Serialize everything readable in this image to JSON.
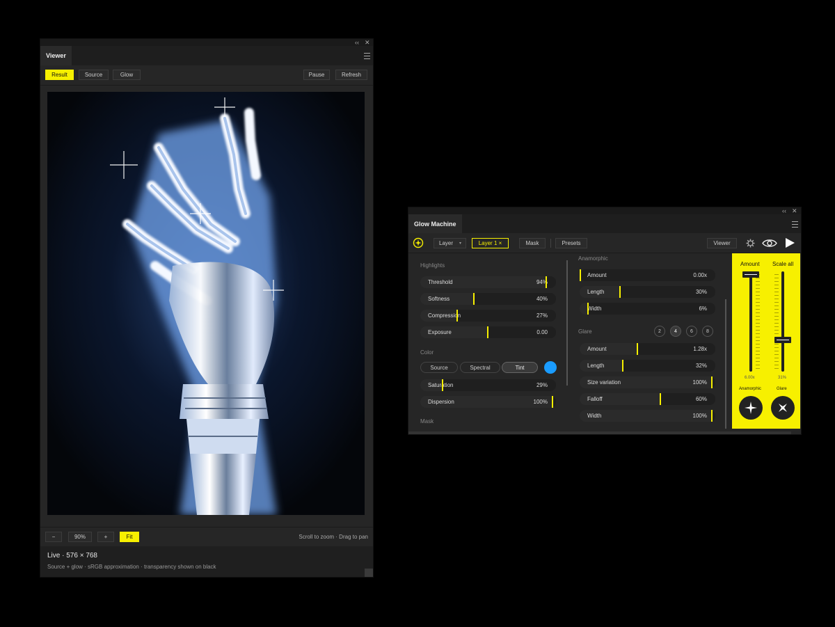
{
  "viewer": {
    "tab": "Viewer",
    "toolbar": {
      "result": "Result",
      "source": "Source",
      "glow": "Glow",
      "pause": "Pause",
      "refresh": "Refresh"
    },
    "zoom": {
      "minus": "−",
      "value": "90%",
      "plus": "+",
      "fit": "Fit"
    },
    "hint": "Scroll to zoom · Drag to pan",
    "status_title": "Live · 576 × 768",
    "status_sub": "Source + glow · sRGB approximation · transparency shown on black",
    "collapse": "‹‹",
    "close": "✕"
  },
  "glow": {
    "tab": "Glow Machine",
    "collapse": "‹‹",
    "close": "✕",
    "toolbar": {
      "layer": "Layer",
      "layer_caret": "▾",
      "layer1": "Layer 1 ×",
      "mask": "Mask",
      "presets": "Presets",
      "viewer": "Viewer"
    },
    "left": {
      "highlights_title": "Highlights",
      "highlights": [
        {
          "label": "Threshold",
          "value": "94%",
          "pos": 0.94
        },
        {
          "label": "Softness",
          "value": "40%",
          "pos": 0.4
        },
        {
          "label": "Compression",
          "value": "27%",
          "pos": 0.27
        },
        {
          "label": "Exposure",
          "value": "0.00",
          "pos": 0.5
        }
      ],
      "color_title": "Color",
      "color_modes": [
        "Source",
        "Spectral",
        "Tint"
      ],
      "tint_color": "#1a9cff",
      "color_rows": [
        {
          "label": "Saturation",
          "value": "29%",
          "pos": 0.16
        },
        {
          "label": "Dispersion",
          "value": "100%",
          "pos": 0.99
        }
      ],
      "mask_title": "Mask"
    },
    "right": {
      "anamorphic_title": "Anamorphic",
      "anamorphic": [
        {
          "label": "Amount",
          "value": "0.00x",
          "pos": 0.0
        },
        {
          "label": "Length",
          "value": "30%",
          "pos": 0.3
        },
        {
          "label": "Width",
          "value": "6%",
          "pos": 0.06
        }
      ],
      "glare_title": "Glare",
      "glare_counts": [
        "2",
        "4",
        "6",
        "8"
      ],
      "glare_selected": "4",
      "glare": [
        {
          "label": "Amount",
          "value": "1.28x",
          "pos": 0.43
        },
        {
          "label": "Length",
          "value": "32%",
          "pos": 0.32
        },
        {
          "label": "Size variation",
          "value": "100%",
          "pos": 0.99
        },
        {
          "label": "Falloff",
          "value": "60%",
          "pos": 0.6
        },
        {
          "label": "Width",
          "value": "100%",
          "pos": 0.99
        }
      ]
    },
    "sliders": {
      "amount_label": "Amount",
      "amount_value": "6.00x",
      "amount_level": 1.0,
      "scale_label": "Scale all",
      "scale_value": "31%",
      "scale_level": 0.31,
      "anamorphic_label": "Anamorphic",
      "glare_label": "Glare"
    },
    "accent": "#f7f000"
  }
}
